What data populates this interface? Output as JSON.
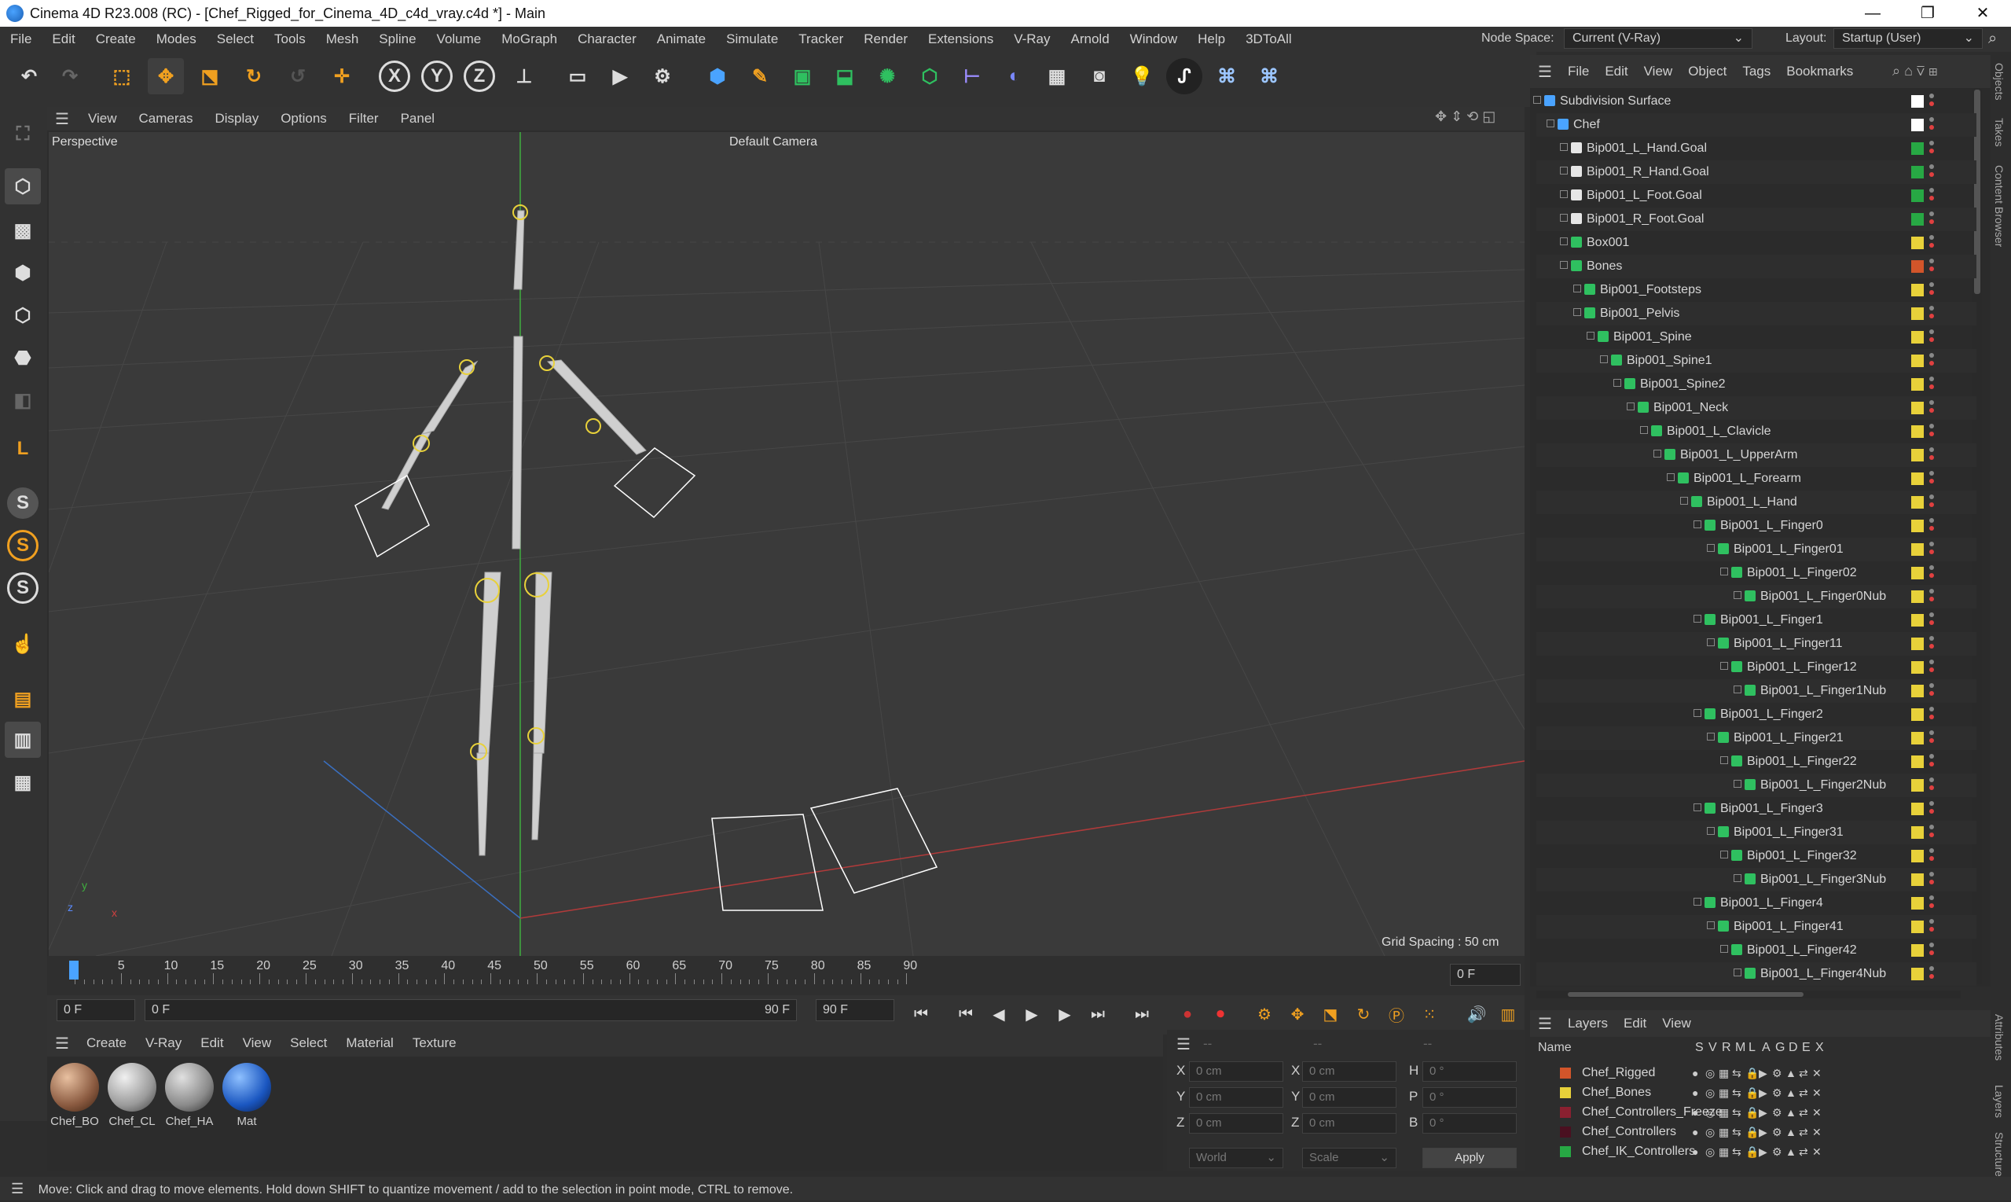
{
  "app": {
    "title": "Cinema 4D R23.008 (RC) - [Chef_Rigged_for_Cinema_4D_c4d_vray.c4d *] - Main",
    "win_min": "—",
    "win_max": "❐",
    "win_close": "✕"
  },
  "menubar": {
    "items": [
      "File",
      "Edit",
      "Create",
      "Modes",
      "Select",
      "Tools",
      "Mesh",
      "Spline",
      "Volume",
      "MoGraph",
      "Character",
      "Animate",
      "Simulate",
      "Tracker",
      "Render",
      "Extensions",
      "V-Ray",
      "Arnold",
      "Window",
      "Help",
      "3DToAll"
    ],
    "node_space_label": "Node Space:",
    "node_space_value": "Current (V-Ray)",
    "layout_label": "Layout:",
    "layout_value": "Startup (User)"
  },
  "toolbar": {
    "axis": [
      "X",
      "Y",
      "Z"
    ]
  },
  "lefttools": {
    "s_labels": [
      "S",
      "S",
      "S"
    ]
  },
  "viewport": {
    "menu": [
      "View",
      "Cameras",
      "Display",
      "Options",
      "Filter",
      "Panel"
    ],
    "name": "Perspective",
    "camera": "Default Camera",
    "grid_spacing": "Grid Spacing : 50 cm",
    "axis_y": "y",
    "axis_z": "z",
    "axis_x": "x"
  },
  "timeline": {
    "ticks": [
      "0",
      "5",
      "10",
      "15",
      "20",
      "25",
      "30",
      "35",
      "40",
      "45",
      "50",
      "55",
      "60",
      "65",
      "70",
      "75",
      "80",
      "85",
      "90"
    ],
    "current_frame": "0 F"
  },
  "transport": {
    "start": "0 F",
    "range_start": "0 F",
    "range_end": "90 F",
    "end": "90 F"
  },
  "materials": {
    "menu": [
      "Create",
      "V-Ray",
      "Edit",
      "View",
      "Select",
      "Material",
      "Texture"
    ],
    "items": [
      {
        "name": "Chef_BO"
      },
      {
        "name": "Chef_CL"
      },
      {
        "name": "Chef_HA"
      },
      {
        "name": "Mat"
      }
    ]
  },
  "coords": {
    "header1": "--",
    "header2": "--",
    "header3": "--",
    "rows": [
      {
        "a": "X",
        "av": "0 cm",
        "b": "X",
        "bv": "0 cm",
        "c": "H",
        "cv": "0 °"
      },
      {
        "a": "Y",
        "av": "0 cm",
        "b": "Y",
        "bv": "0 cm",
        "c": "P",
        "cv": "0 °"
      },
      {
        "a": "Z",
        "av": "0 cm",
        "b": "Z",
        "bv": "0 cm",
        "c": "B",
        "cv": "0 °"
      }
    ],
    "world": "World",
    "scale": "Scale",
    "apply": "Apply"
  },
  "objects": {
    "menu": [
      "File",
      "Edit",
      "View",
      "Object",
      "Tags",
      "Bookmarks"
    ],
    "rows": [
      {
        "name": "Subdivision Surface",
        "indent": 0,
        "tag": "#ffffff"
      },
      {
        "name": "Chef",
        "indent": 1,
        "tag": "#ffffff"
      },
      {
        "name": "Bip001_L_Hand.Goal",
        "indent": 2,
        "tag": "#27a844"
      },
      {
        "name": "Bip001_R_Hand.Goal",
        "indent": 2,
        "tag": "#27a844"
      },
      {
        "name": "Bip001_L_Foot.Goal",
        "indent": 2,
        "tag": "#27a844"
      },
      {
        "name": "Bip001_R_Foot.Goal",
        "indent": 2,
        "tag": "#27a844"
      },
      {
        "name": "Box001",
        "indent": 2,
        "tag": "#e8d13a"
      },
      {
        "name": "Bones",
        "indent": 2,
        "tag": "#d2552a"
      },
      {
        "name": "Bip001_Footsteps",
        "indent": 3,
        "tag": "#e8d13a"
      },
      {
        "name": "Bip001_Pelvis",
        "indent": 3,
        "tag": "#e8d13a"
      },
      {
        "name": "Bip001_Spine",
        "indent": 4,
        "tag": "#e8d13a"
      },
      {
        "name": "Bip001_Spine1",
        "indent": 5,
        "tag": "#e8d13a"
      },
      {
        "name": "Bip001_Spine2",
        "indent": 6,
        "tag": "#e8d13a"
      },
      {
        "name": "Bip001_Neck",
        "indent": 7,
        "tag": "#e8d13a"
      },
      {
        "name": "Bip001_L_Clavicle",
        "indent": 8,
        "tag": "#e8d13a"
      },
      {
        "name": "Bip001_L_UpperArm",
        "indent": 9,
        "tag": "#e8d13a"
      },
      {
        "name": "Bip001_L_Forearm",
        "indent": 10,
        "tag": "#e8d13a"
      },
      {
        "name": "Bip001_L_Hand",
        "indent": 11,
        "tag": "#e8d13a"
      },
      {
        "name": "Bip001_L_Finger0",
        "indent": 12,
        "tag": "#e8d13a"
      },
      {
        "name": "Bip001_L_Finger01",
        "indent": 13,
        "tag": "#e8d13a"
      },
      {
        "name": "Bip001_L_Finger02",
        "indent": 14,
        "tag": "#e8d13a"
      },
      {
        "name": "Bip001_L_Finger0Nub",
        "indent": 15,
        "tag": "#e8d13a"
      },
      {
        "name": "Bip001_L_Finger1",
        "indent": 12,
        "tag": "#e8d13a"
      },
      {
        "name": "Bip001_L_Finger11",
        "indent": 13,
        "tag": "#e8d13a"
      },
      {
        "name": "Bip001_L_Finger12",
        "indent": 14,
        "tag": "#e8d13a"
      },
      {
        "name": "Bip001_L_Finger1Nub",
        "indent": 15,
        "tag": "#e8d13a"
      },
      {
        "name": "Bip001_L_Finger2",
        "indent": 12,
        "tag": "#e8d13a"
      },
      {
        "name": "Bip001_L_Finger21",
        "indent": 13,
        "tag": "#e8d13a"
      },
      {
        "name": "Bip001_L_Finger22",
        "indent": 14,
        "tag": "#e8d13a"
      },
      {
        "name": "Bip001_L_Finger2Nub",
        "indent": 15,
        "tag": "#e8d13a"
      },
      {
        "name": "Bip001_L_Finger3",
        "indent": 12,
        "tag": "#e8d13a"
      },
      {
        "name": "Bip001_L_Finger31",
        "indent": 13,
        "tag": "#e8d13a"
      },
      {
        "name": "Bip001_L_Finger32",
        "indent": 14,
        "tag": "#e8d13a"
      },
      {
        "name": "Bip001_L_Finger3Nub",
        "indent": 15,
        "tag": "#e8d13a"
      },
      {
        "name": "Bip001_L_Finger4",
        "indent": 12,
        "tag": "#e8d13a"
      },
      {
        "name": "Bip001_L_Finger41",
        "indent": 13,
        "tag": "#e8d13a"
      },
      {
        "name": "Bip001_L_Finger42",
        "indent": 14,
        "tag": "#e8d13a"
      },
      {
        "name": "Bip001_L_Finger4Nub",
        "indent": 15,
        "tag": "#e8d13a"
      }
    ]
  },
  "layers": {
    "menu": [
      "Layers",
      "Edit",
      "View"
    ],
    "name_col": "Name",
    "cols": [
      "S",
      "V",
      "R",
      "M",
      "L",
      "A",
      "G",
      "D",
      "E",
      "X"
    ],
    "rows": [
      {
        "name": "Chef_Rigged",
        "color": "#d2552a"
      },
      {
        "name": "Chef_Bones",
        "color": "#e8d13a"
      },
      {
        "name": "Chef_Controllers_Freeze",
        "color": "#8a2030"
      },
      {
        "name": "Chef_Controllers",
        "color": "#4a1020"
      },
      {
        "name": "Chef_IK_Controllers",
        "color": "#27a844"
      }
    ]
  },
  "sidetabs": [
    "Objects",
    "Takes",
    "Content Browser",
    "Attributes",
    "Layers",
    "Structure"
  ],
  "status": "Move: Click and drag to move elements. Hold down SHIFT to quantize movement / add to the selection in point mode, CTRL to remove."
}
